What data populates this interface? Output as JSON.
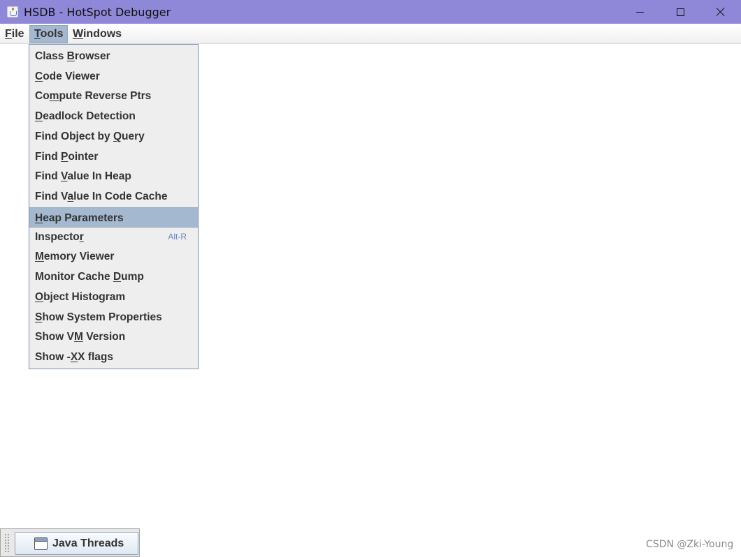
{
  "window": {
    "title": "HSDB - HotSpot Debugger",
    "icon": "java-cup-icon"
  },
  "menubar": {
    "file": {
      "pre": "",
      "mnemonic": "F",
      "post": "ile"
    },
    "tools": {
      "pre": "",
      "mnemonic": "T",
      "post": "ools"
    },
    "windows": {
      "pre": "",
      "mnemonic": "W",
      "post": "indows"
    }
  },
  "tools_menu": {
    "items": [
      {
        "pre": "Class ",
        "mnemonic": "B",
        "post": "rowser"
      },
      {
        "pre": "",
        "mnemonic": "C",
        "post": "ode Viewer"
      },
      {
        "pre": "Co",
        "mnemonic": "m",
        "post": "pute Reverse Ptrs"
      },
      {
        "pre": "",
        "mnemonic": "D",
        "post": "eadlock Detection"
      },
      {
        "pre": "Find Object by ",
        "mnemonic": "Q",
        "post": "uery"
      },
      {
        "pre": "Find ",
        "mnemonic": "P",
        "post": "ointer"
      },
      {
        "pre": "Find ",
        "mnemonic": "V",
        "post": "alue In Heap"
      },
      {
        "pre": "Find V",
        "mnemonic": "a",
        "post": "lue In Code Cache"
      },
      {
        "pre": "",
        "mnemonic": "H",
        "post": "eap Parameters",
        "selected": true
      },
      {
        "pre": "Inspecto",
        "mnemonic": "r",
        "post": "",
        "accelerator": "Alt-R"
      },
      {
        "pre": "",
        "mnemonic": "M",
        "post": "emory Viewer"
      },
      {
        "pre": "Monitor Cache ",
        "mnemonic": "D",
        "post": "ump"
      },
      {
        "pre": "",
        "mnemonic": "O",
        "post": "bject Histogram"
      },
      {
        "pre": "",
        "mnemonic": "S",
        "post": "how System Properties"
      },
      {
        "pre": "Show V",
        "mnemonic": "M",
        "post": " Version"
      },
      {
        "pre": "Show -",
        "mnemonic": "X",
        "post": "X flags"
      }
    ]
  },
  "taskbar": {
    "java_threads_label": "Java Threads",
    "java_threads_icon": "window-icon"
  },
  "watermark": "CSDN @Zki-Young"
}
